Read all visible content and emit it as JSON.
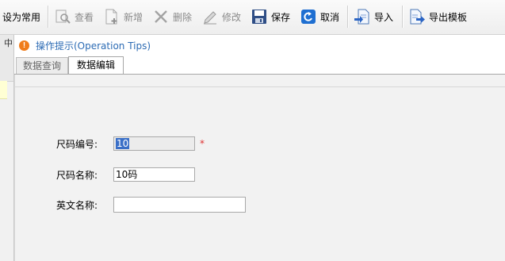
{
  "toolbar": {
    "set_default_label": "设为常用",
    "view_label": "查看",
    "new_label": "新增",
    "delete_label": "删除",
    "edit_label": "修改",
    "save_label": "保存",
    "cancel_label": "取消",
    "import_label": "导入",
    "export_template_label": "导出模板"
  },
  "left_strip": {
    "glyph": "中"
  },
  "tips": {
    "text": "操作提示(Operation Tips)"
  },
  "tabs": [
    {
      "label": "数据查询",
      "active": false
    },
    {
      "label": "数据编辑",
      "active": true
    }
  ],
  "form": {
    "size_code_label": "尺码编号:",
    "size_code_value": "10",
    "required_mark": "*",
    "size_name_label": "尺码名称:",
    "size_name_value": "10码",
    "english_name_label": "英文名称:",
    "english_name_value": ""
  },
  "colors": {
    "tips_text": "#2c6bb4",
    "warning_icon": "#f07c1b",
    "required": "#e03030",
    "selection": "#3a6fc7"
  }
}
